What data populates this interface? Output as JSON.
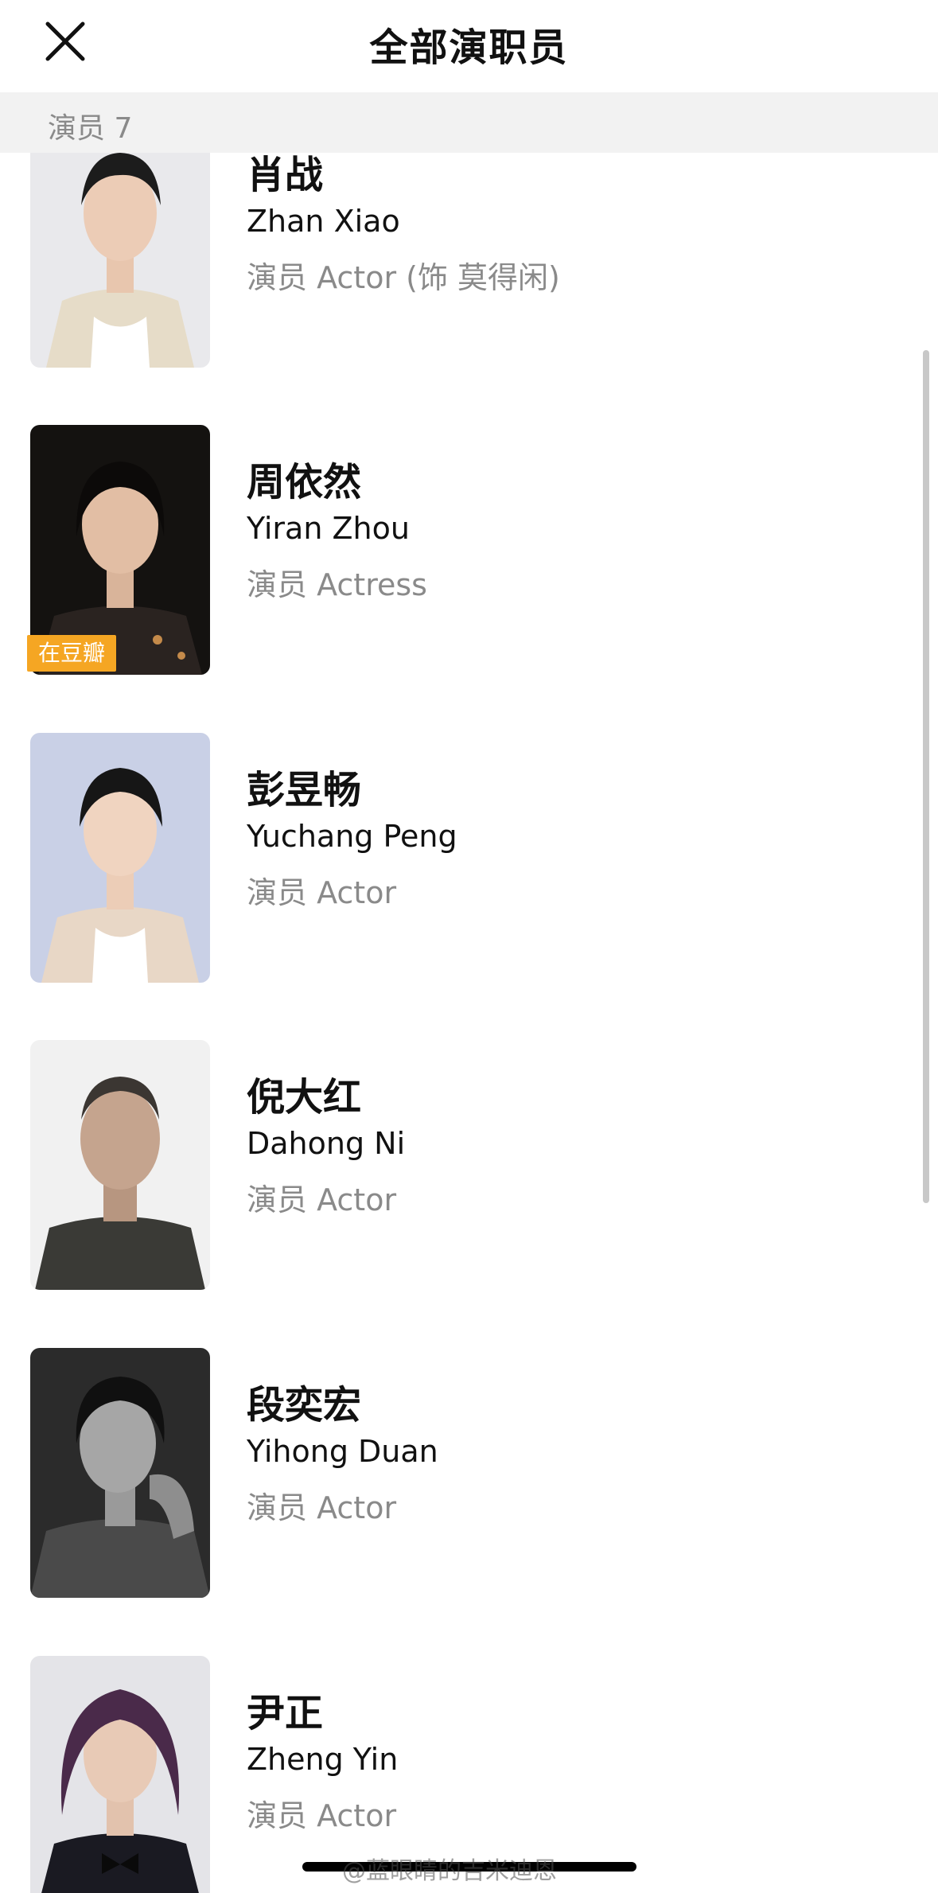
{
  "header": {
    "title": "全部演职员",
    "close_icon": "close-icon"
  },
  "section": {
    "label": "演员 7"
  },
  "cast": [
    {
      "name_cn": "肖战",
      "name_en": "Zhan Xiao",
      "role": "演员 Actor (饰 莫得闲)",
      "badge": ""
    },
    {
      "name_cn": "周依然",
      "name_en": "Yiran Zhou",
      "role": "演员 Actress",
      "badge": "在豆瓣"
    },
    {
      "name_cn": "彭昱畅",
      "name_en": "Yuchang Peng",
      "role": "演员 Actor",
      "badge": ""
    },
    {
      "name_cn": "倪大红",
      "name_en": "Dahong Ni",
      "role": "演员 Actor",
      "badge": ""
    },
    {
      "name_cn": "段奕宏",
      "name_en": "Yihong Duan",
      "role": "演员 Actor",
      "badge": ""
    },
    {
      "name_cn": "尹正",
      "name_en": "Zheng Yin",
      "role": "演员 Actor",
      "badge": ""
    }
  ],
  "watermark": "@蓝眼睛的吉米迪恩",
  "colors": {
    "badge": "#f5a623",
    "section_bg": "#f2f2f2",
    "secondary_text": "#8a8a8a"
  }
}
